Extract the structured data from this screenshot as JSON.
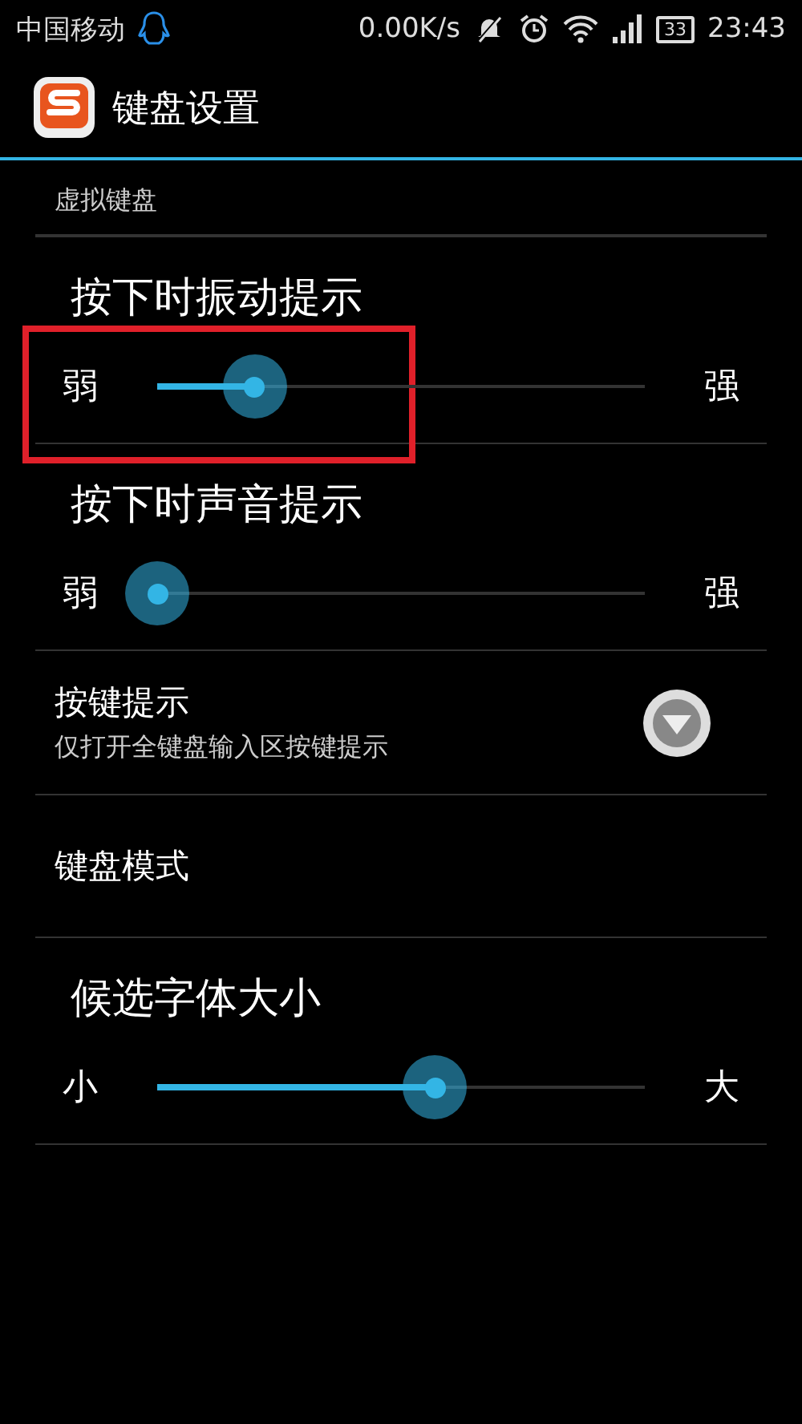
{
  "status_bar": {
    "carrier": "中国移动",
    "speed": "0.00K/s",
    "battery": "33",
    "time": "23:43"
  },
  "action_bar": {
    "title": "键盘设置"
  },
  "section": {
    "title": "虚拟键盘"
  },
  "items": [
    {
      "kind": "slider",
      "title": "按下时振动提示",
      "min_label": "弱",
      "max_label": "强",
      "level": 0.2,
      "highlighted": true
    },
    {
      "kind": "slider",
      "title": "按下时声音提示",
      "min_label": "弱",
      "max_label": "强",
      "level": 0,
      "highlighted": false
    },
    {
      "kind": "toggle",
      "title": "按键提示",
      "summary": "仅打开全键盘输入区按键提示",
      "expanded": false
    },
    {
      "kind": "plain",
      "title": "键盘模式"
    },
    {
      "kind": "slider",
      "title": "候选字体大小",
      "min_label": "小",
      "max_label": "大",
      "level": 0.57,
      "highlighted": false
    }
  ]
}
